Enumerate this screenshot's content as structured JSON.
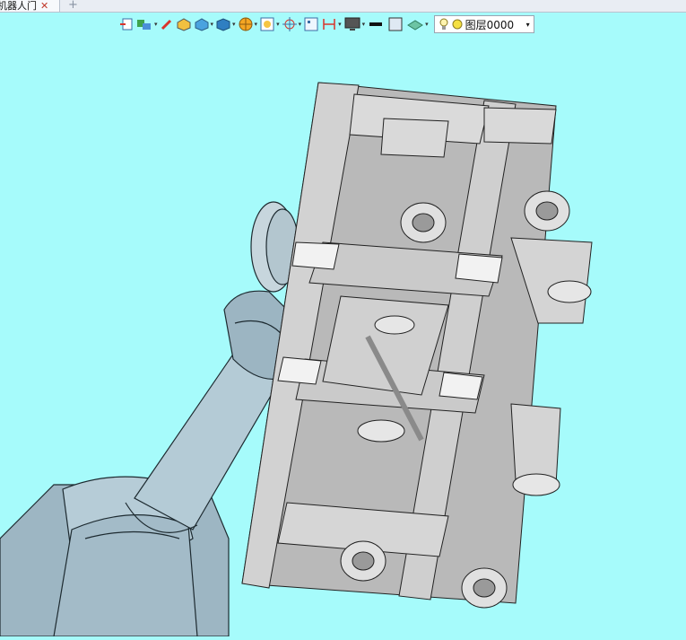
{
  "tab": {
    "title": "机器人门",
    "close_glyph": "✕",
    "new_glyph": "+"
  },
  "toolbar": {
    "dropdown_glyph": "▾",
    "items": [
      "exit-sketch",
      "materials",
      "edit-pencil",
      "solid-box",
      "solid-shade",
      "view-cube",
      "render-style",
      "snap-options",
      "point-snap",
      "measure-frame",
      "dimension",
      "display-monitor",
      "line-style",
      "fill-color",
      "plane-visibility"
    ],
    "layer": {
      "name": "图层0000",
      "caret": "▾"
    }
  },
  "colors": {
    "background": "#a6fbfb",
    "robot": "#a9c2cf",
    "frame": "#bfbfbf"
  }
}
